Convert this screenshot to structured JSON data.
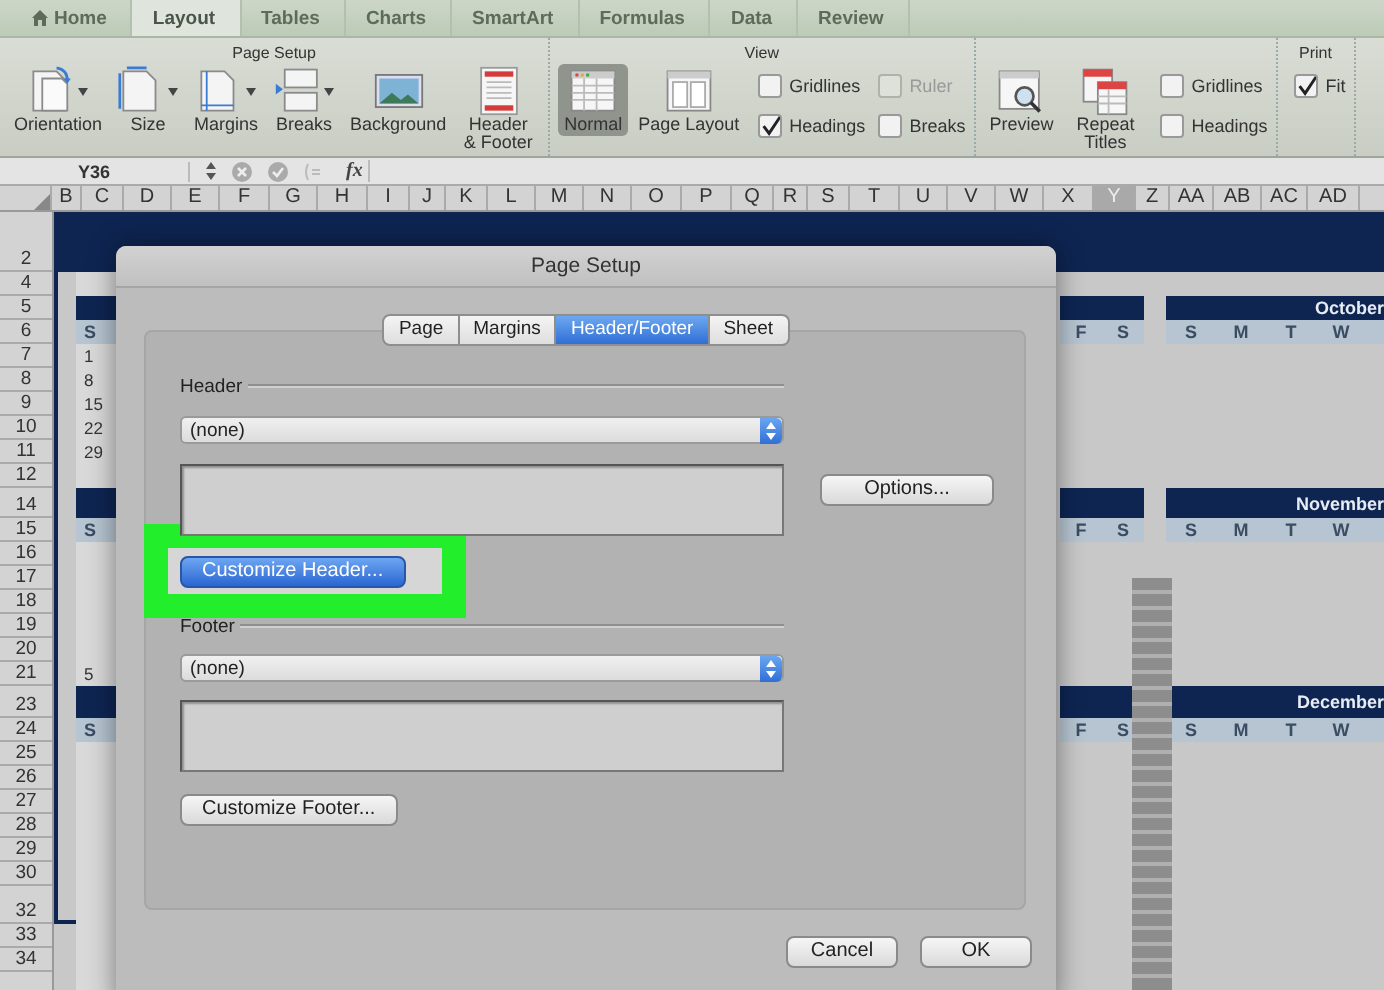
{
  "ribbon_tabs": [
    {
      "label": "Home",
      "selected": false
    },
    {
      "label": "Layout",
      "selected": true
    },
    {
      "label": "Tables",
      "selected": false
    },
    {
      "label": "Charts",
      "selected": false
    },
    {
      "label": "SmartArt",
      "selected": false
    },
    {
      "label": "Formulas",
      "selected": false
    },
    {
      "label": "Data",
      "selected": false
    },
    {
      "label": "Review",
      "selected": false
    }
  ],
  "ribbon_groups": [
    {
      "title": "Page Setup",
      "items": [
        {
          "kind": "button",
          "label": "Orientation",
          "menu": true
        },
        {
          "kind": "button",
          "label": "Size",
          "menu": true
        },
        {
          "kind": "button",
          "label": "Margins",
          "menu": true
        },
        {
          "kind": "button",
          "label": "Breaks",
          "menu": true
        },
        {
          "kind": "button",
          "label": "Background",
          "menu": false
        },
        {
          "kind": "button",
          "label": "Header & Footer",
          "menu": false
        }
      ]
    },
    {
      "title": "View",
      "items": [
        {
          "kind": "button",
          "label": "Normal",
          "selected": true
        },
        {
          "kind": "button",
          "label": "Page Layout",
          "selected": false
        },
        {
          "kind": "checkboxes",
          "options": [
            {
              "label": "Gridlines",
              "checked": false,
              "disabled": false
            },
            {
              "label": "Headings",
              "checked": true,
              "disabled": false
            }
          ]
        },
        {
          "kind": "checkboxes",
          "options": [
            {
              "label": "Ruler",
              "checked": false,
              "disabled": true
            },
            {
              "label": "Breaks",
              "checked": false,
              "disabled": false
            }
          ]
        }
      ]
    },
    {
      "items": [
        {
          "kind": "button",
          "label": "Preview"
        },
        {
          "kind": "button",
          "label": "Repeat Titles"
        },
        {
          "kind": "checkboxes",
          "options": [
            {
              "label": "Gridlines",
              "checked": false,
              "disabled": false
            },
            {
              "label": "Headings",
              "checked": false,
              "disabled": false
            }
          ]
        }
      ]
    },
    {
      "title": "Print",
      "items": [
        {
          "kind": "checkboxes",
          "options": [
            {
              "label": "Fit",
              "checked": true,
              "disabled": false
            }
          ]
        }
      ]
    }
  ],
  "formula_bar": {
    "name_box": "Y36",
    "function_label": "fx"
  },
  "columns": [
    {
      "label": "B",
      "selected": false
    },
    {
      "label": "C",
      "selected": false
    },
    {
      "label": "D",
      "selected": false
    },
    {
      "label": "E",
      "selected": false
    },
    {
      "label": "F",
      "selected": false
    },
    {
      "label": "G",
      "selected": false
    },
    {
      "label": "H",
      "selected": false
    },
    {
      "label": "I",
      "selected": false
    },
    {
      "label": "J",
      "selected": false
    },
    {
      "label": "K",
      "selected": false
    },
    {
      "label": "L",
      "selected": false
    },
    {
      "label": "M",
      "selected": false
    },
    {
      "label": "N",
      "selected": false
    },
    {
      "label": "O",
      "selected": false
    },
    {
      "label": "P",
      "selected": false
    },
    {
      "label": "Q",
      "selected": false
    },
    {
      "label": "R",
      "selected": false
    },
    {
      "label": "S",
      "selected": false
    },
    {
      "label": "T",
      "selected": false
    },
    {
      "label": "U",
      "selected": false
    },
    {
      "label": "V",
      "selected": false
    },
    {
      "label": "W",
      "selected": false
    },
    {
      "label": "X",
      "selected": false
    },
    {
      "label": "Y",
      "selected": true
    },
    {
      "label": "Z",
      "selected": false
    },
    {
      "label": "AA",
      "selected": false
    },
    {
      "label": "AB",
      "selected": false
    },
    {
      "label": "AC",
      "selected": false
    },
    {
      "label": "AD",
      "selected": false
    }
  ],
  "rows": [
    "2",
    "4",
    "5",
    "6",
    "7",
    "8",
    "9",
    "10",
    "11",
    "12",
    "14",
    "15",
    "16",
    "17",
    "18",
    "19",
    "20",
    "21",
    "23",
    "24",
    "25",
    "26",
    "27",
    "28",
    "29",
    "30",
    "32",
    "33",
    "34"
  ],
  "left_calendar": [
    {
      "kind": "band"
    },
    {
      "kind": "day",
      "label": "S"
    },
    {
      "kind": "number",
      "label": "1"
    },
    {
      "kind": "number",
      "label": "8"
    },
    {
      "kind": "number",
      "label": "15"
    },
    {
      "kind": "number",
      "label": "22"
    },
    {
      "kind": "number",
      "label": "29"
    },
    {
      "kind": "band"
    },
    {
      "kind": "day",
      "label": "S"
    },
    {
      "kind": "number",
      "label": "5"
    },
    {
      "kind": "band"
    },
    {
      "kind": "day",
      "label": "S"
    }
  ],
  "months": [
    {
      "name": "October",
      "prev_days": [
        "F",
        "S"
      ],
      "days": [
        "S",
        "M",
        "T",
        "W"
      ]
    },
    {
      "name": "November",
      "prev_days": [
        "F",
        "S"
      ],
      "days": [
        "S",
        "M",
        "T",
        "W"
      ]
    },
    {
      "name": "December",
      "prev_days": [
        "F",
        "S"
      ],
      "days": [
        "S",
        "M",
        "T",
        "W"
      ]
    }
  ],
  "dialog": {
    "title": "Page Setup",
    "tabs": [
      {
        "label": "Page",
        "selected": false
      },
      {
        "label": "Margins",
        "selected": false
      },
      {
        "label": "Header/Footer",
        "selected": true
      },
      {
        "label": "Sheet",
        "selected": false
      }
    ],
    "sections": [
      {
        "label": "Header",
        "dropdown": "(none)",
        "button": "Customize Header...",
        "highlighted": true
      },
      {
        "label": "Footer",
        "dropdown": "(none)",
        "button": "Customize Footer...",
        "highlighted": false
      }
    ],
    "options_button": "Options...",
    "buttons": [
      "Cancel",
      "OK"
    ]
  }
}
